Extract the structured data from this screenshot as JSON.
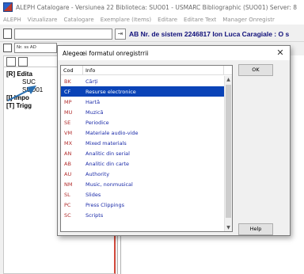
{
  "window": {
    "title": "ALEPH Catalogare - Versiunea 22 Biblioteca: SUO01 - USMARC Bibliographic (SUO01) Server: 8"
  },
  "menu": {
    "items": [
      "ALEPH",
      "Vizualizare",
      "Catalogare",
      "Exemplare (Items)",
      "Editare",
      "Editare Text",
      "Manager Onregistr"
    ]
  },
  "toolbar": {
    "header_text": "AB Nr. de sistem 2246817 Ion Luca Caragiale : O s"
  },
  "toolbar2": {
    "field_text": "Nr. ss AD"
  },
  "tree": {
    "items": [
      {
        "label": "[R] Edita"
      },
      {
        "label": "SUC"
      },
      {
        "label": "SUO01"
      },
      {
        "label": "[I] Impo"
      },
      {
        "label": "[T] Trigg"
      }
    ]
  },
  "dialog": {
    "title": "Alegeœi formatul onregistrrii",
    "close_label": "✕",
    "columns": {
      "cod": "Cod",
      "info": "Info"
    },
    "rows": [
      {
        "cod": "BK",
        "info": "Cărți",
        "selected": false
      },
      {
        "cod": "CF",
        "info": "Resurse electronice",
        "selected": true
      },
      {
        "cod": "MP",
        "info": "Hartă",
        "selected": false
      },
      {
        "cod": "MU",
        "info": "Muzică",
        "selected": false
      },
      {
        "cod": "SE",
        "info": "Periodice",
        "selected": false
      },
      {
        "cod": "VM",
        "info": "Materiale audio-vide",
        "selected": false
      },
      {
        "cod": "MX",
        "info": "Mixed materials",
        "selected": false
      },
      {
        "cod": "AN",
        "info": "Analitic din serial",
        "selected": false
      },
      {
        "cod": "AB",
        "info": "Analitic din carte",
        "selected": false
      },
      {
        "cod": "AU",
        "info": "Authority",
        "selected": false
      },
      {
        "cod": "NM",
        "info": "Music, nonmusical",
        "selected": false
      },
      {
        "cod": "SL",
        "info": "Slides",
        "selected": false
      },
      {
        "cod": "PC",
        "info": "Press Clippings",
        "selected": false
      },
      {
        "cod": "SC",
        "info": "Scripts",
        "selected": false
      }
    ],
    "ok_label": "OK",
    "help_label": "Help"
  },
  "colors": {
    "selection": "#0a43b7",
    "code_text": "#b22d2d",
    "info_text": "#1a2aa8",
    "header_text": "#10107a",
    "panel_border_accent": "#d24a3c",
    "arrow": "#2a6fb0"
  },
  "icons": {
    "app": "aleph-app-icon",
    "close": "close-icon",
    "scroll_up": "scroll-up-arrow-icon",
    "scroll_down": "scroll-down-arrow-icon",
    "pointer_arrow": "pointer-arrow-icon"
  }
}
